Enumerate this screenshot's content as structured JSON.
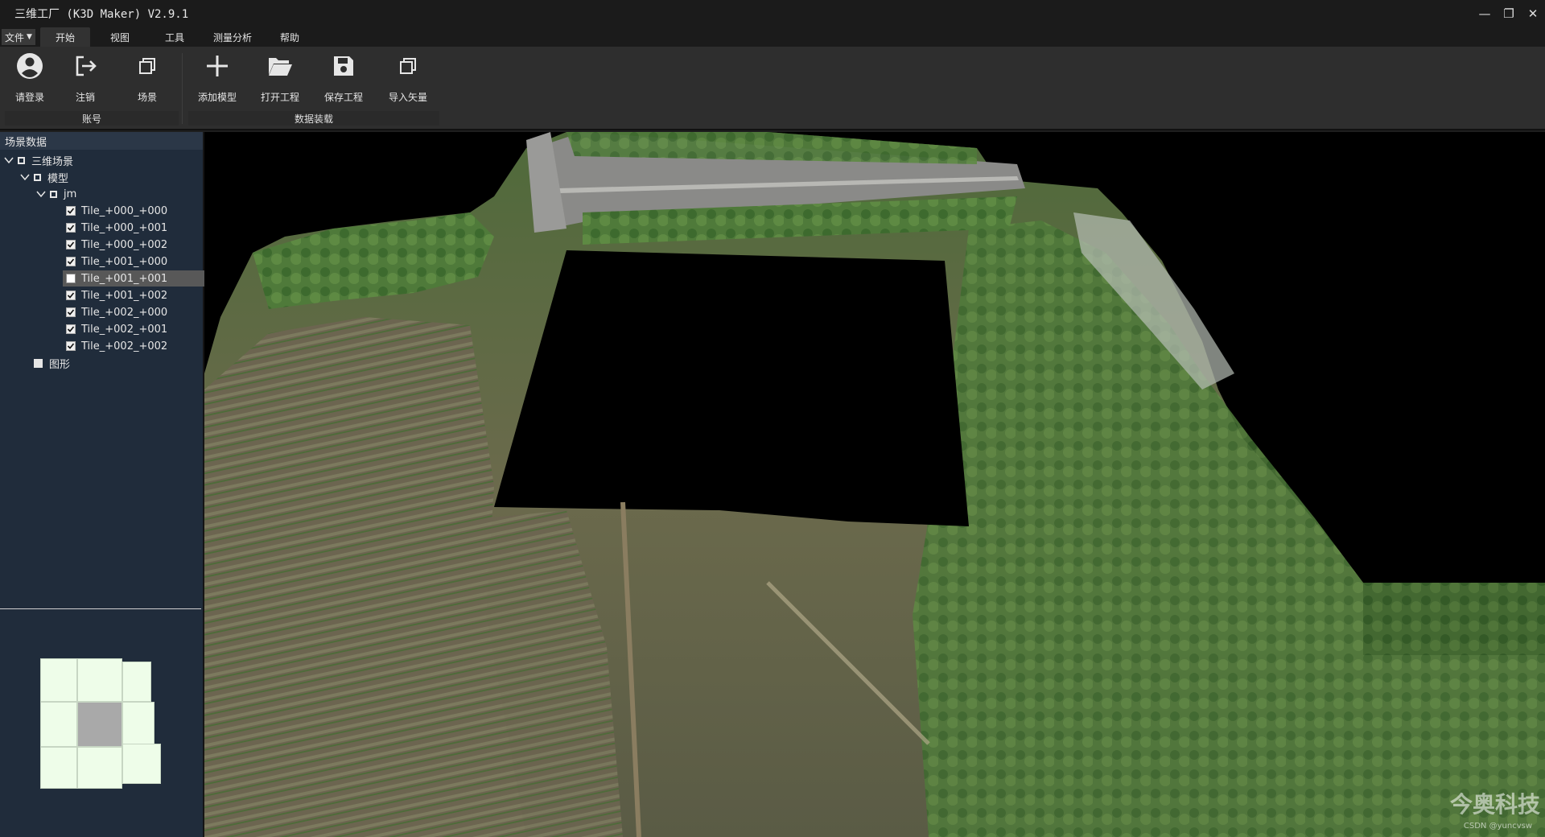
{
  "app": {
    "title": "三维工厂 (K3D Maker) V2.9.1"
  },
  "window_controls": {
    "minimize": "—",
    "restore": "❐",
    "close": "✕"
  },
  "menu": {
    "file": "文件",
    "tabs": [
      {
        "label": "开始",
        "active": true
      },
      {
        "label": "视图"
      },
      {
        "label": "工具"
      },
      {
        "label": "测量分析"
      },
      {
        "label": "帮助"
      }
    ]
  },
  "ribbon": {
    "buttons": [
      {
        "label": "请登录",
        "icon": "user-icon"
      },
      {
        "label": "注销",
        "icon": "logout-icon"
      },
      {
        "label": "场景",
        "icon": "copy-icon"
      },
      {
        "label": "添加模型",
        "icon": "plus-icon"
      },
      {
        "label": "打开工程",
        "icon": "folder-open-icon"
      },
      {
        "label": "保存工程",
        "icon": "save-icon"
      },
      {
        "label": "导入矢量",
        "icon": "copy-icon"
      }
    ],
    "groups": [
      {
        "label": "账号"
      },
      {
        "label": "数据装载"
      }
    ]
  },
  "scene_panel": {
    "title": "场景数据",
    "tree": {
      "root": "三维场景",
      "model": "模型",
      "jm": "jm",
      "tiles": [
        {
          "label": "Tile_+000_+000",
          "checked": true
        },
        {
          "label": "Tile_+000_+001",
          "checked": true
        },
        {
          "label": "Tile_+000_+002",
          "checked": true
        },
        {
          "label": "Tile_+001_+000",
          "checked": true
        },
        {
          "label": "Tile_+001_+001",
          "checked": false
        },
        {
          "label": "Tile_+001_+002",
          "checked": true
        },
        {
          "label": "Tile_+002_+000",
          "checked": true
        },
        {
          "label": "Tile_+002_+001",
          "checked": true
        },
        {
          "label": "Tile_+002_+002",
          "checked": true
        }
      ],
      "shapes": "图形"
    }
  },
  "watermark": {
    "brand": "今奥科技",
    "credit": "CSDN @yuncvsw"
  },
  "colors": {
    "panel_bg": "#202c3b",
    "ribbon_bg": "#2e2e2e",
    "tile_on": "#eefde9",
    "tile_off": "#a9a9a9"
  }
}
